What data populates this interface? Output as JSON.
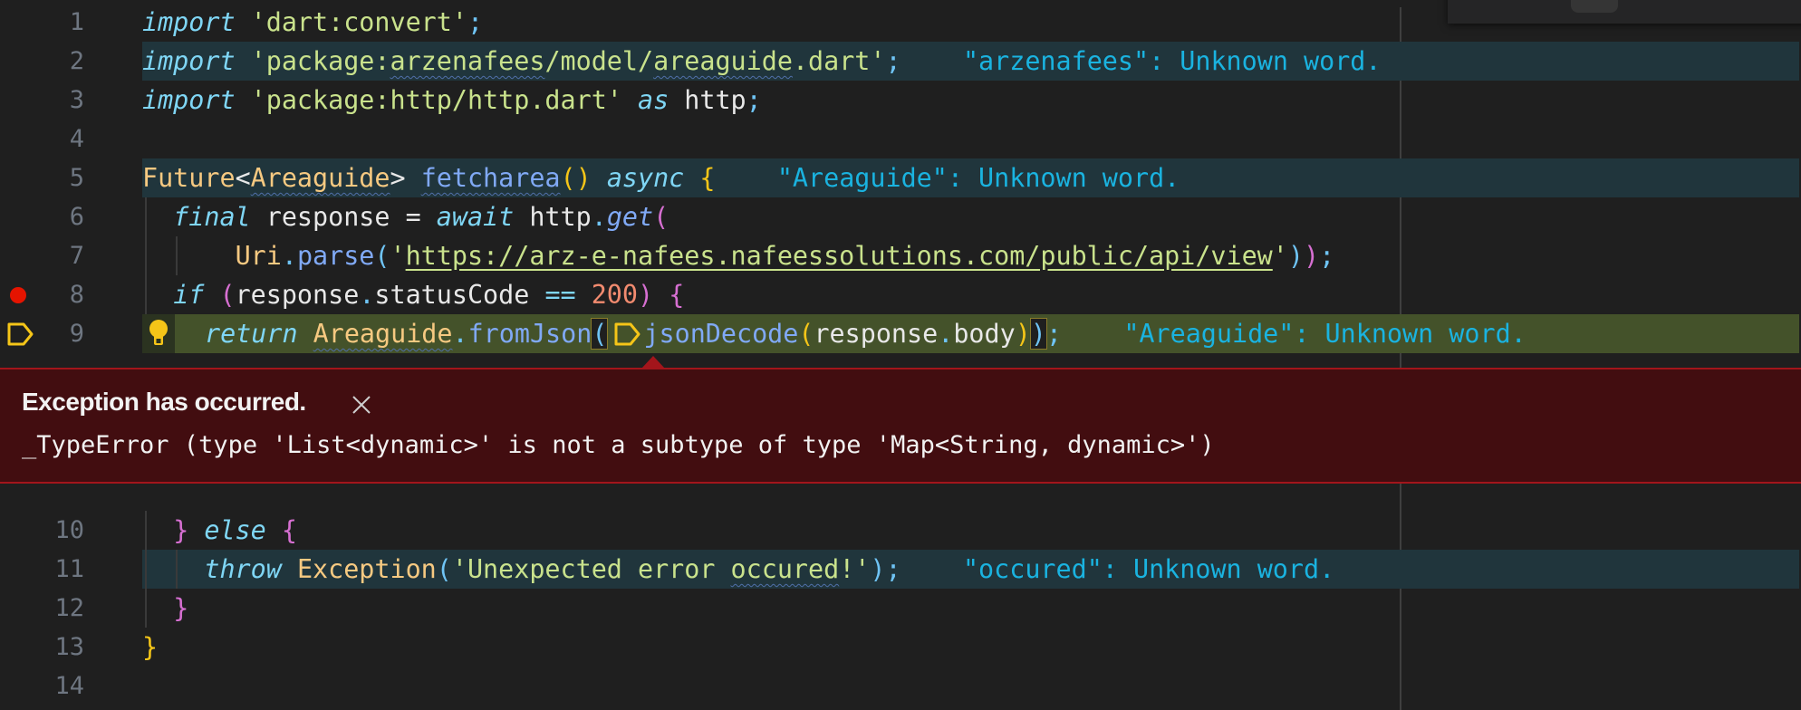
{
  "editor": {
    "lines": [
      {
        "number": "1"
      },
      {
        "number": "2",
        "hint": "\"arzenafees\": Unknown word."
      },
      {
        "number": "3"
      },
      {
        "number": "4"
      },
      {
        "number": "5",
        "hint": "\"Areaguide\": Unknown word."
      },
      {
        "number": "6"
      },
      {
        "number": "7"
      },
      {
        "number": "8",
        "breakpoint": true
      },
      {
        "number": "9",
        "current": true,
        "hint": "\"Areaguide\": Unknown word."
      },
      {
        "number": "10"
      },
      {
        "number": "11",
        "hint": "\"occured\": Unknown word."
      },
      {
        "number": "12"
      },
      {
        "number": "13"
      },
      {
        "number": "14"
      }
    ],
    "tokens": {
      "l1": [
        "import",
        " ",
        "'dart:convert'",
        ";"
      ],
      "l2": [
        "import",
        " ",
        "'package:",
        "arzenafees",
        "/model/",
        "areaguide",
        ".dart'",
        ";"
      ],
      "l3": [
        "import",
        " ",
        "'package:http/http.dart'",
        " ",
        "as",
        " http",
        ";"
      ],
      "l5": [
        "Future",
        "<",
        "Areaguide",
        ">",
        " ",
        "fetcharea",
        "()",
        " ",
        "async",
        " ",
        "{"
      ],
      "l6": [
        "  ",
        "final",
        " response = ",
        "await",
        " http",
        ".",
        "get",
        "("
      ],
      "l7": [
        "      ",
        "Uri",
        ".",
        "parse",
        "(",
        "'",
        "https://arz-e-nafees.nafeessolutions.com/public/api/view",
        "'",
        ")",
        ")",
        ";"
      ],
      "l8": [
        "  ",
        "if",
        " ",
        "(",
        "response",
        ".",
        "statusCode ",
        "==",
        " ",
        "200",
        ")",
        " ",
        "{"
      ],
      "l9": [
        "return",
        " ",
        "Areaguide",
        ".",
        "fromJson",
        "(",
        "jsonDecode",
        "(",
        "response",
        ".",
        "body",
        ")",
        ")",
        ";"
      ],
      "l10": [
        "  ",
        "}",
        " ",
        "else",
        " ",
        "{"
      ],
      "l11": [
        "    ",
        "throw",
        " ",
        "Exception",
        "(",
        "'Unexpected error ",
        "occured",
        "!'",
        ")",
        ";"
      ],
      "l12": [
        "  ",
        "}"
      ],
      "l13": [
        "}"
      ]
    }
  },
  "exception": {
    "title": "Exception has occurred.",
    "message": "_TypeError (type 'List<dynamic>' is not a subtype of type 'Map<String, dynamic>')"
  },
  "colors": {
    "breakpoint": "#e51400",
    "debug_pointer": "#f5c518",
    "exception_bg": "#420d10",
    "exception_border": "#a3151b",
    "current_line": "#44522a",
    "hint": "#1ab3e0"
  }
}
